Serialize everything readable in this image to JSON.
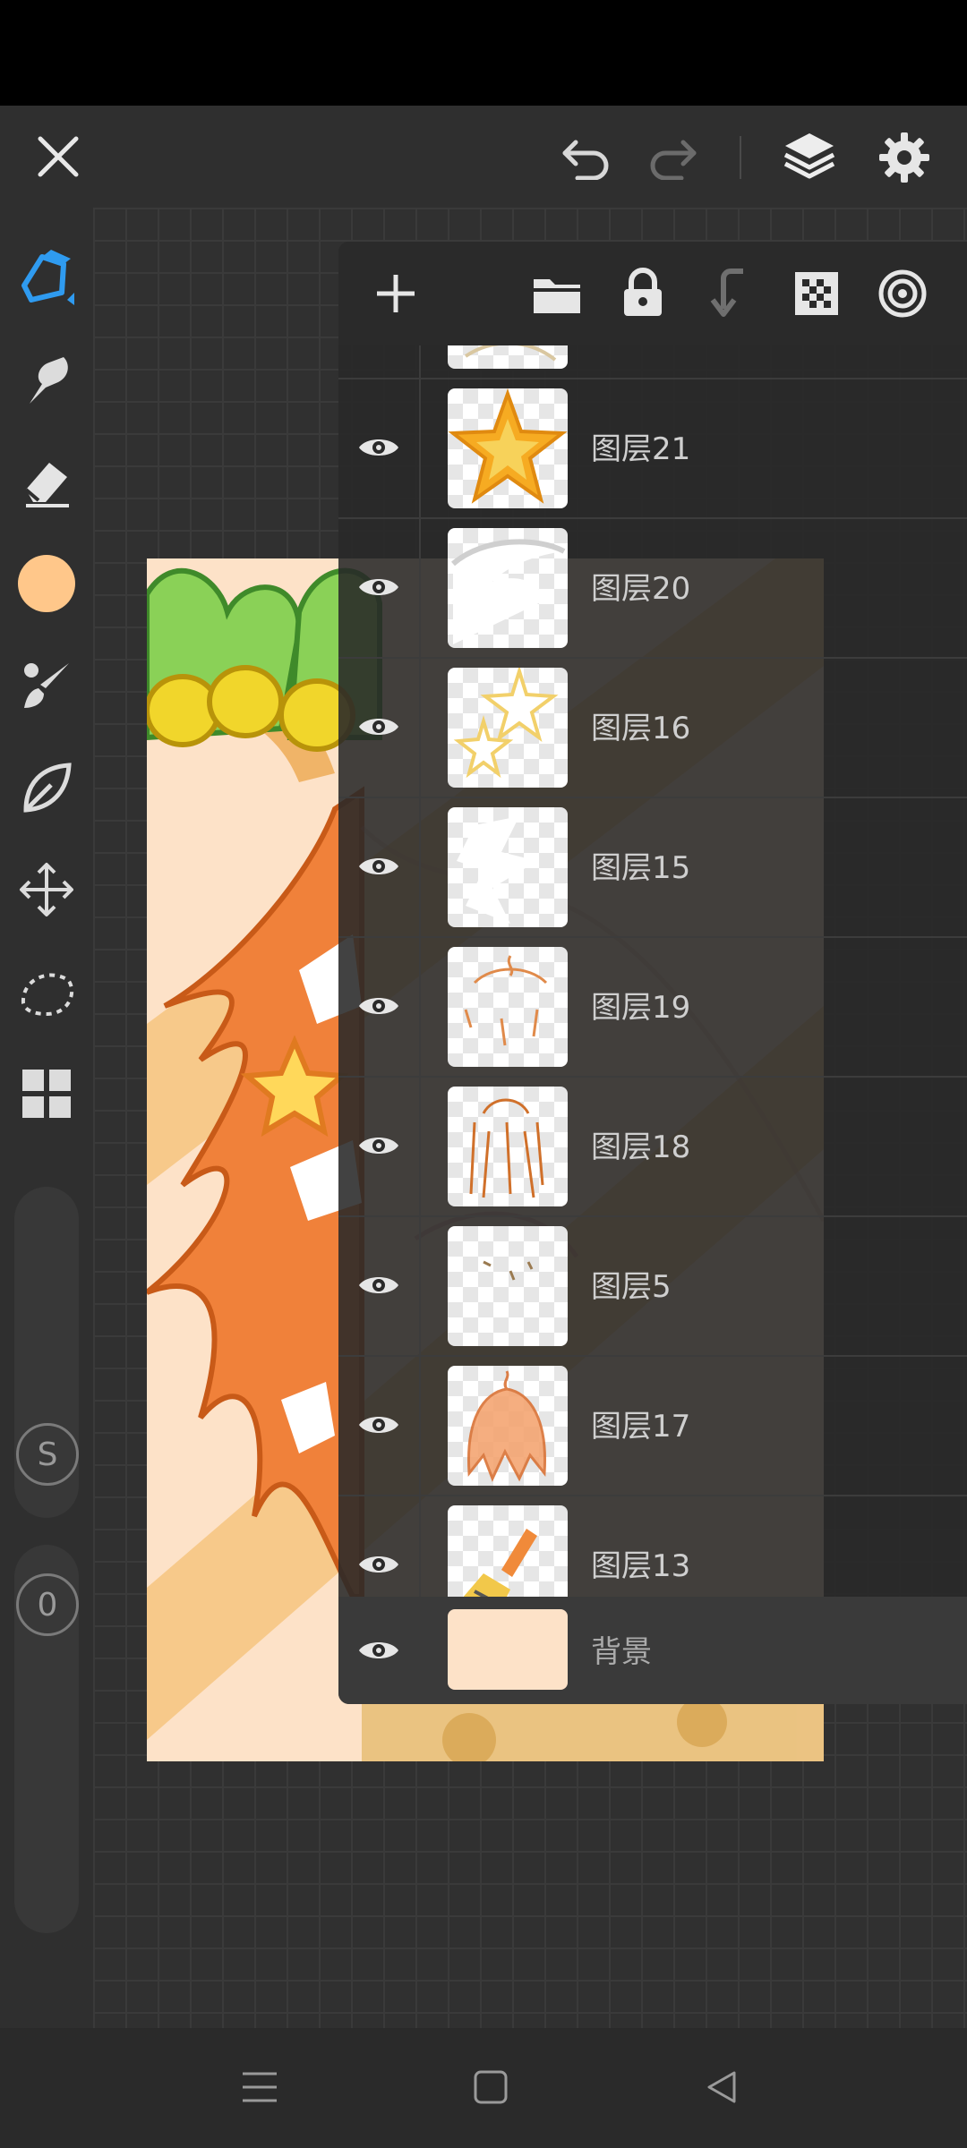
{
  "colors": {
    "accent": "#2f9bf0",
    "current_color": "#ffc78a",
    "background_layer": "#fde2c8"
  },
  "topbar": {
    "icons": [
      "close-icon",
      "undo-icon",
      "redo-icon",
      "layers-icon",
      "gear-icon"
    ]
  },
  "sidebar": {
    "tools": [
      "pen-icon",
      "smudge-icon",
      "eraser-icon",
      "color-swatch",
      "brush-icon",
      "leaf-icon",
      "move-icon",
      "lasso-icon",
      "grid-icon"
    ],
    "size_label": "S",
    "opacity_label": "0"
  },
  "layers_panel": {
    "toolbar_icons": [
      "add-layer-icon",
      "folder-icon",
      "lock-icon",
      "merge-down-icon",
      "transparency-icon",
      "opacity-icon"
    ],
    "layers": [
      {
        "name": "图层21",
        "visible": true
      },
      {
        "name": "图层20",
        "visible": true
      },
      {
        "name": "图层16",
        "visible": true
      },
      {
        "name": "图层15",
        "visible": true
      },
      {
        "name": "图层19",
        "visible": true
      },
      {
        "name": "图层18",
        "visible": true
      },
      {
        "name": "图层5",
        "visible": true
      },
      {
        "name": "图层17",
        "visible": true
      },
      {
        "name": "图层13",
        "visible": true
      }
    ],
    "background_layer": {
      "name": "背景",
      "visible": true
    }
  },
  "navbar": {
    "icons": [
      "menu-icon",
      "home-icon",
      "back-icon"
    ]
  }
}
